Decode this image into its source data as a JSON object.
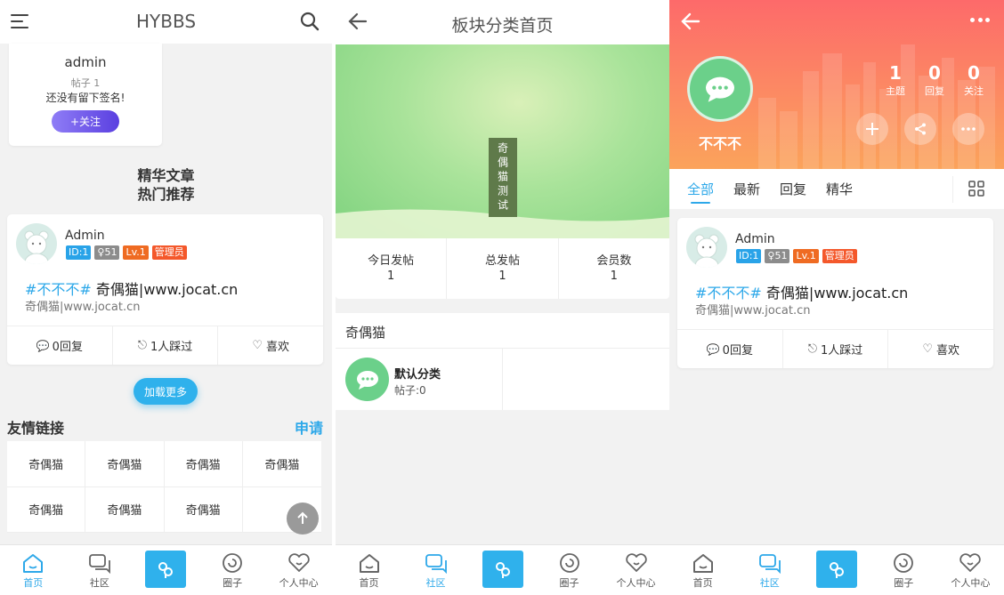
{
  "panel1": {
    "header": {
      "title": "HYBBS"
    },
    "profile_card": {
      "name": "admin",
      "posts": "帖子 1",
      "signature": "还没有留下签名!",
      "follow": "+关注"
    },
    "section_titles": [
      "精华文章",
      "热门推荐"
    ],
    "post": {
      "author": "Admin",
      "badges": [
        "ID:1",
        "51",
        "Lv.1",
        "管理员"
      ],
      "tag": "#不不不#",
      "title": "奇偶猫|www.jocat.cn",
      "excerpt": "奇偶猫|www.jocat.cn",
      "actions": [
        "0回复",
        "1人踩过",
        "喜欢"
      ]
    },
    "load_more": "加载更多",
    "links": {
      "title": "友情链接",
      "apply": "申请",
      "items": [
        "奇偶猫",
        "奇偶猫",
        "奇偶猫",
        "奇偶猫",
        "奇偶猫",
        "奇偶猫",
        "奇偶猫",
        ""
      ]
    },
    "tabbar": [
      "首页",
      "社区",
      "",
      "圈子",
      "个人中心"
    ]
  },
  "panel2": {
    "header": {
      "title": "板块分类首页"
    },
    "banner_label": "奇偶猫测试",
    "stats": [
      {
        "label": "今日发帖",
        "value": "1"
      },
      {
        "label": "总发帖",
        "value": "1"
      },
      {
        "label": "会员数",
        "value": "1"
      }
    ],
    "section_title": "奇偶猫",
    "category": {
      "name": "默认分类",
      "posts": "帖子:0"
    },
    "tabbar": [
      "首页",
      "社区",
      "",
      "圈子",
      "个人中心"
    ]
  },
  "panel3": {
    "user": {
      "name": "不不不"
    },
    "counts": [
      {
        "value": "1",
        "label": "主题"
      },
      {
        "value": "0",
        "label": "回复"
      },
      {
        "value": "0",
        "label": "关注"
      }
    ],
    "tabs": [
      "全部",
      "最新",
      "回复",
      "精华"
    ],
    "post": {
      "author": "Admin",
      "badges": [
        "ID:1",
        "51",
        "Lv.1",
        "管理员"
      ],
      "tag": "#不不不#",
      "title": "奇偶猫|www.jocat.cn",
      "excerpt": "奇偶猫|www.jocat.cn",
      "actions": [
        "0回复",
        "1人踩过",
        "喜欢"
      ]
    },
    "tabbar": [
      "首页",
      "社区",
      "",
      "圈子",
      "个人中心"
    ]
  },
  "colors": {
    "accent": "#2da8e9",
    "tab_center": "#2fb1ec",
    "header_gradient_top": "#fd6a6a",
    "header_gradient_bottom": "#fba35b",
    "follow_btn": "#6d5ff0",
    "chat_green": "#6bd08a"
  }
}
